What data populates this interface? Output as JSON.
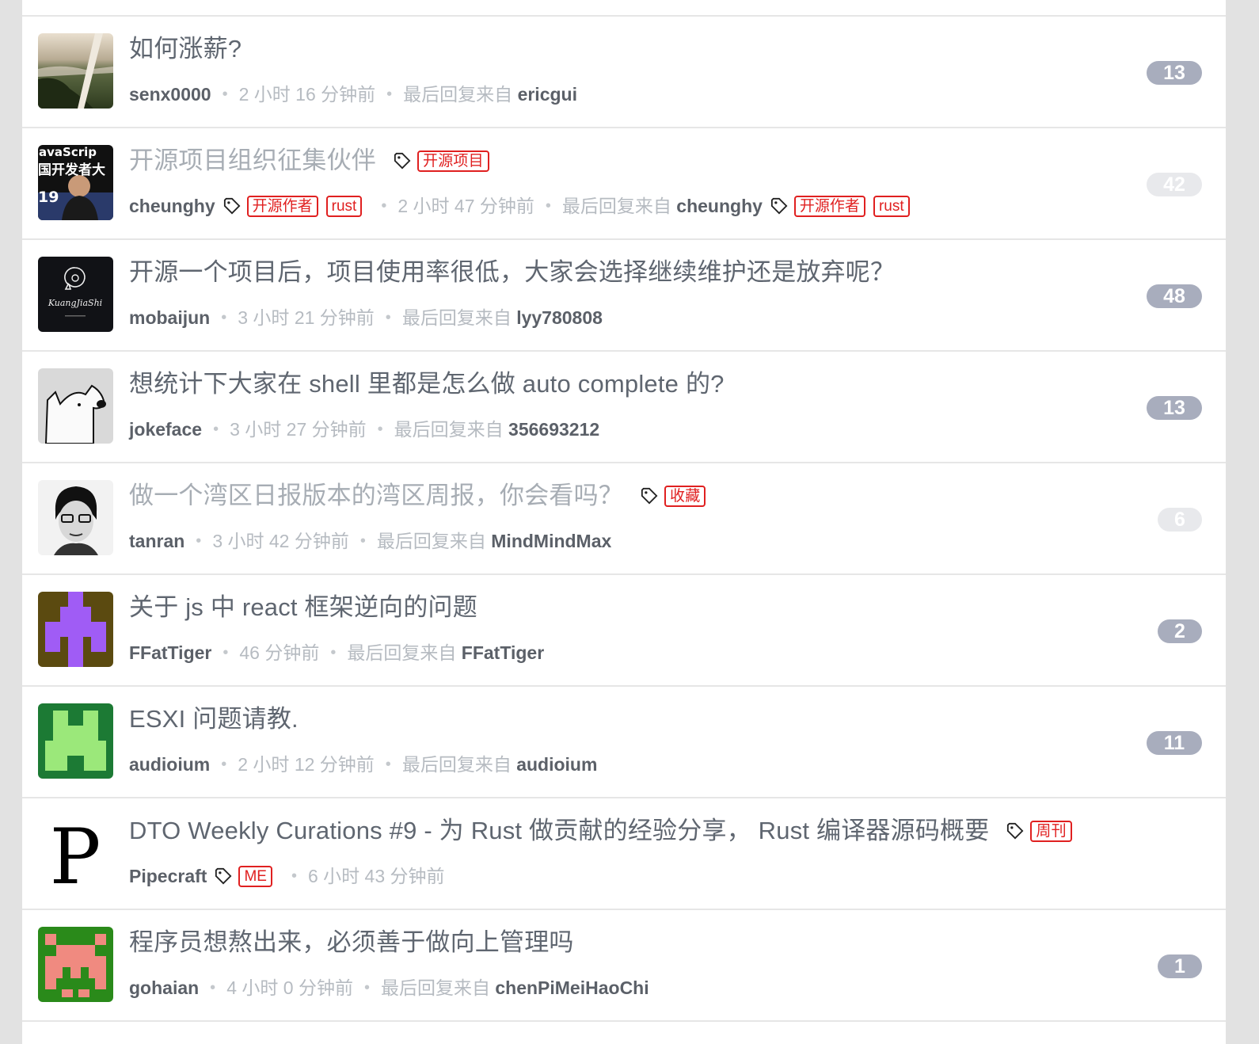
{
  "topics": [
    {
      "title": "如何涨薪?",
      "user": "senx0000",
      "time": "2 小时 16 分钟前",
      "last_prefix": "最后回复来自",
      "last_user": "ericgui",
      "count": "13"
    },
    {
      "title": "开源项目组织征集伙伴",
      "title_tags": [
        "开源项目"
      ],
      "user": "cheunghy",
      "user_tags": [
        "开源作者",
        "rust"
      ],
      "time": "2 小时 47 分钟前",
      "last_prefix": "最后回复来自",
      "last_user": "cheunghy",
      "last_user_tags": [
        "开源作者",
        "rust"
      ],
      "count": "42"
    },
    {
      "title": "开源一个项目后，项目使用率很低，大家会选择继续维护还是放弃呢？",
      "user": "mobaijun",
      "time": "3 小时 21 分钟前",
      "last_prefix": "最后回复来自",
      "last_user": "lyy780808",
      "count": "48",
      "avatar_text": "KuangJiaShi"
    },
    {
      "title": "想统计下大家在 shell 里都是怎么做 auto complete 的?",
      "user": "jokeface",
      "time": "3 小时 27 分钟前",
      "last_prefix": "最后回复来自",
      "last_user": "356693212",
      "count": "13"
    },
    {
      "title": "做一个湾区日报版本的湾区周报，你会看吗？",
      "title_tags": [
        "收藏"
      ],
      "user": "tanran",
      "time": "3 小时 42 分钟前",
      "last_prefix": "最后回复来自",
      "last_user": "MindMindMax",
      "count": "6"
    },
    {
      "title": "关于 js 中 react 框架逆向的问题",
      "user": "FFatTiger",
      "time": "46 分钟前",
      "last_prefix": "最后回复来自",
      "last_user": "FFatTiger",
      "count": "2"
    },
    {
      "title": "ESXI 问题请教.",
      "user": "audioium",
      "time": "2 小时 12 分钟前",
      "last_prefix": "最后回复来自",
      "last_user": "audioium",
      "count": "11"
    },
    {
      "title": "DTO Weekly Curations #9 - 为 Rust 做贡献的经验分享， Rust 编译器源码概要",
      "title_tags": [
        "周刊"
      ],
      "user": "Pipecraft",
      "user_tags": [
        "ME"
      ],
      "time": "6 小时 43 分钟前",
      "count": "",
      "avatar_text": "P"
    },
    {
      "title": "程序员想熬出来，必须善于做向上管理吗",
      "user": "gohaian",
      "time": "4 小时 0 分钟前",
      "last_prefix": "最后回复来自",
      "last_user": "chenPiMeiHaoChi",
      "count": "1"
    }
  ],
  "avatar_banner": {
    "line1": "avaScrip",
    "line2": "国开发者大",
    "line3": "19"
  },
  "colors": {
    "tag_red": "#e02020",
    "count_bg": "#a8adbd",
    "count_light": "#e8e9ec",
    "meta_grey": "#b6bbc1",
    "user_dark": "#5b6068"
  }
}
